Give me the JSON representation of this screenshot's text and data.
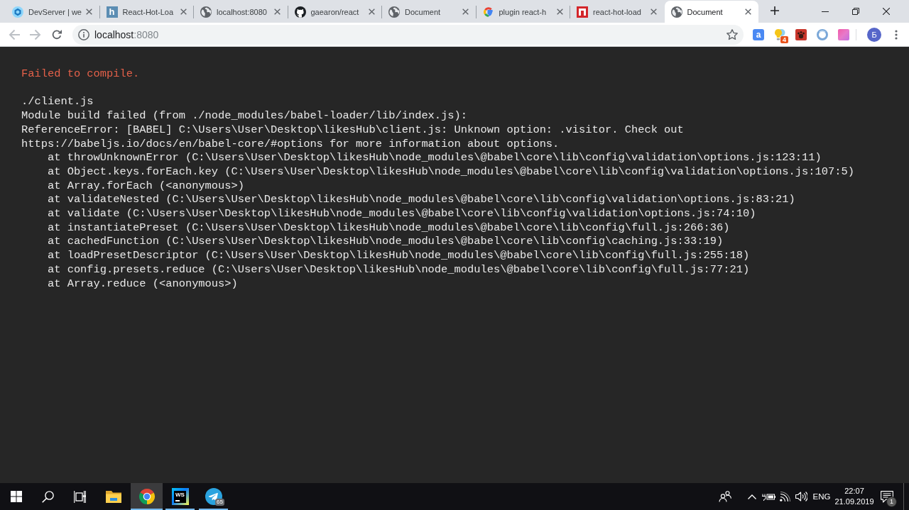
{
  "browser": {
    "tabs": [
      {
        "kind": "cube",
        "title": "DevServer | we",
        "selected": false
      },
      {
        "kind": "tile",
        "icon_text": "h",
        "title": "React-Hot-Loa",
        "selected": false
      },
      {
        "kind": "globe",
        "title": "localhost:8080",
        "selected": false
      },
      {
        "kind": "cat",
        "title": "gaearon/react",
        "selected": false
      },
      {
        "kind": "globe",
        "title": "Document",
        "selected": false
      },
      {
        "kind": "ring",
        "title": "plugin react-h",
        "selected": false
      },
      {
        "kind": "frame",
        "title": "react-hot-load",
        "selected": false
      },
      {
        "kind": "globe",
        "title": "Document",
        "selected": true
      }
    ],
    "toolbar": {
      "back": {
        "disabled": true
      },
      "forward": {
        "disabled": true
      },
      "address": {
        "domain": "localhost",
        "suffix": ":8080"
      },
      "bookmarked": false,
      "extensions": [
        {
          "kind": "translate",
          "icon_text": "a"
        },
        {
          "kind": "bulb",
          "badge": "4"
        },
        {
          "kind": "tile"
        },
        {
          "kind": "ring"
        },
        {
          "kind": "gradient"
        }
      ],
      "profile": {
        "initial": "Б"
      }
    }
  },
  "overlay": {
    "title": "Failed to compile.",
    "lines": [
      "./client.js",
      "Module build failed (from ./node_modules/babel-loader/lib/index.js):",
      "ReferenceError: [BABEL] C:\\Users\\User\\Desktop\\likesHub\\client.js: Unknown option: .visitor. Check out https://babeljs.io/docs/en/babel-core/#options for more information about options."
    ],
    "stack": [
      "at throwUnknownError (C:\\Users\\User\\Desktop\\likesHub\\node_modules\\@babel\\core\\lib\\config\\validation\\options.js:123:11)",
      "at Object.keys.forEach.key (C:\\Users\\User\\Desktop\\likesHub\\node_modules\\@babel\\core\\lib\\config\\validation\\options.js:107:5)",
      "at Array.forEach (<anonymous>)",
      "at validateNested (C:\\Users\\User\\Desktop\\likesHub\\node_modules\\@babel\\core\\lib\\config\\validation\\options.js:83:21)",
      "at validate (C:\\Users\\User\\Desktop\\likesHub\\node_modules\\@babel\\core\\lib\\config\\validation\\options.js:74:10)",
      "at instantiatePreset (C:\\Users\\User\\Desktop\\likesHub\\node_modules\\@babel\\core\\lib\\config\\full.js:266:36)",
      "at cachedFunction (C:\\Users\\User\\Desktop\\likesHub\\node_modules\\@babel\\core\\lib\\config\\caching.js:33:19)",
      "at loadPresetDescriptor (C:\\Users\\User\\Desktop\\likesHub\\node_modules\\@babel\\core\\lib\\config\\full.js:255:18)",
      "at config.presets.reduce (C:\\Users\\User\\Desktop\\likesHub\\node_modules\\@babel\\core\\lib\\config\\full.js:77:21)",
      "at Array.reduce (<anonymous>)"
    ]
  },
  "taskbar": {
    "apps": [
      {
        "kind": "folder",
        "running": false,
        "selected": false
      },
      {
        "kind": "browser",
        "running": true,
        "selected": true
      },
      {
        "kind": "ide",
        "icon_text": "WS",
        "running": true,
        "selected": false
      },
      {
        "kind": "messenger",
        "badge": "65",
        "running": true,
        "selected": false
      }
    ],
    "tray": {
      "language": "ENG",
      "time": "22:07",
      "date": "21.09.2019",
      "notifications": "1"
    }
  }
}
